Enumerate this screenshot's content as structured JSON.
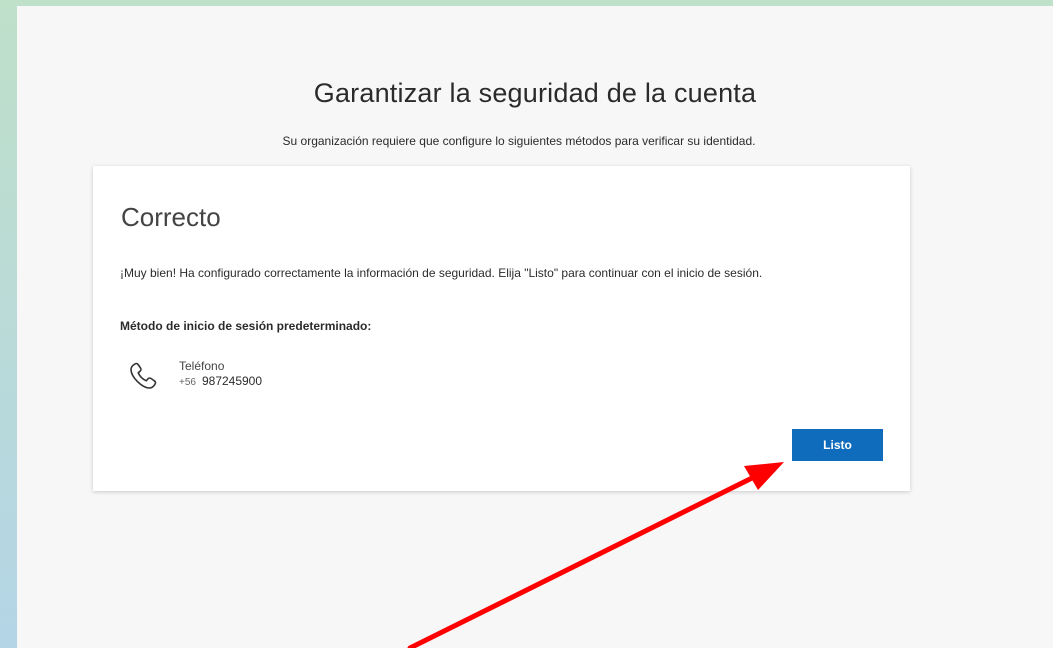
{
  "header": {
    "title": "Garantizar la seguridad de la cuenta",
    "subtitle": "Su organización requiere que configure lo siguientes métodos para verificar su identidad."
  },
  "card": {
    "title": "Correcto",
    "message": "¡Muy bien! Ha configurado correctamente la información de seguridad. Elija \"Listo\" para continuar con el inicio de sesión.",
    "default_method_label": "Método de inicio de sesión predeterminado:",
    "method": {
      "icon": "phone-icon",
      "name": "Teléfono",
      "country_code": "+56",
      "number": "987245900"
    },
    "done_button": "Listo"
  },
  "colors": {
    "accent": "#0f6cbd",
    "annotation_arrow": "#ff0000",
    "background_top": "#bfe0c9",
    "background_bottom": "#b4d5e6"
  }
}
